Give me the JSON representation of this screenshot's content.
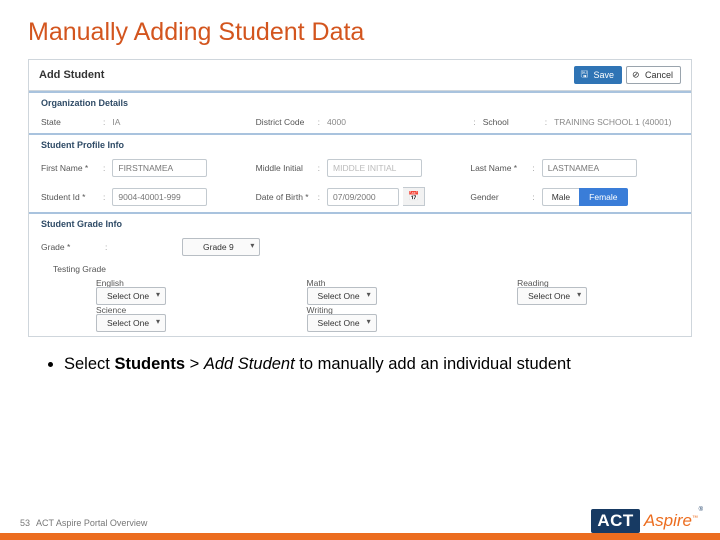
{
  "title": "Manually Adding Student Data",
  "panel": {
    "heading": "Add Student",
    "save": "Save",
    "cancel": "Cancel"
  },
  "org": {
    "header": "Organization Details",
    "state_lbl": "State",
    "state_val": "IA",
    "district_lbl": "District Code",
    "district_val": "4000",
    "school_lbl": "School",
    "school_val": "TRAINING SCHOOL 1 (40001)"
  },
  "profile": {
    "header": "Student Profile Info",
    "first_lbl": "First Name *",
    "first_val": "FIRSTNAMEA",
    "mid_lbl": "Middle Initial",
    "mid_ph": "MIDDLE INITIAL",
    "last_lbl": "Last Name *",
    "last_val": "LASTNAMEA",
    "id_lbl": "Student Id *",
    "id_val": "9004-40001-999",
    "dob_lbl": "Date of Birth *",
    "dob_val": "07/09/2000",
    "gender_lbl": "Gender",
    "male": "Male",
    "female": "Female"
  },
  "gradeinfo": {
    "header": "Student Grade Info",
    "grade_lbl": "Grade *",
    "grade_val": "Grade 9",
    "test_lbl": "Testing Grade",
    "english": "English",
    "math": "Math",
    "reading": "Reading",
    "science": "Science",
    "writing": "Writing",
    "select": "Select One"
  },
  "bullet": {
    "pre": "Select ",
    "b": "Students",
    "mid": " > ",
    "i": "Add Student",
    "post": " to manually add an individual student"
  },
  "footer": {
    "page": "53",
    "label": "ACT Aspire Portal Overview",
    "logo1": "ACT",
    "logo2": "Aspire"
  }
}
